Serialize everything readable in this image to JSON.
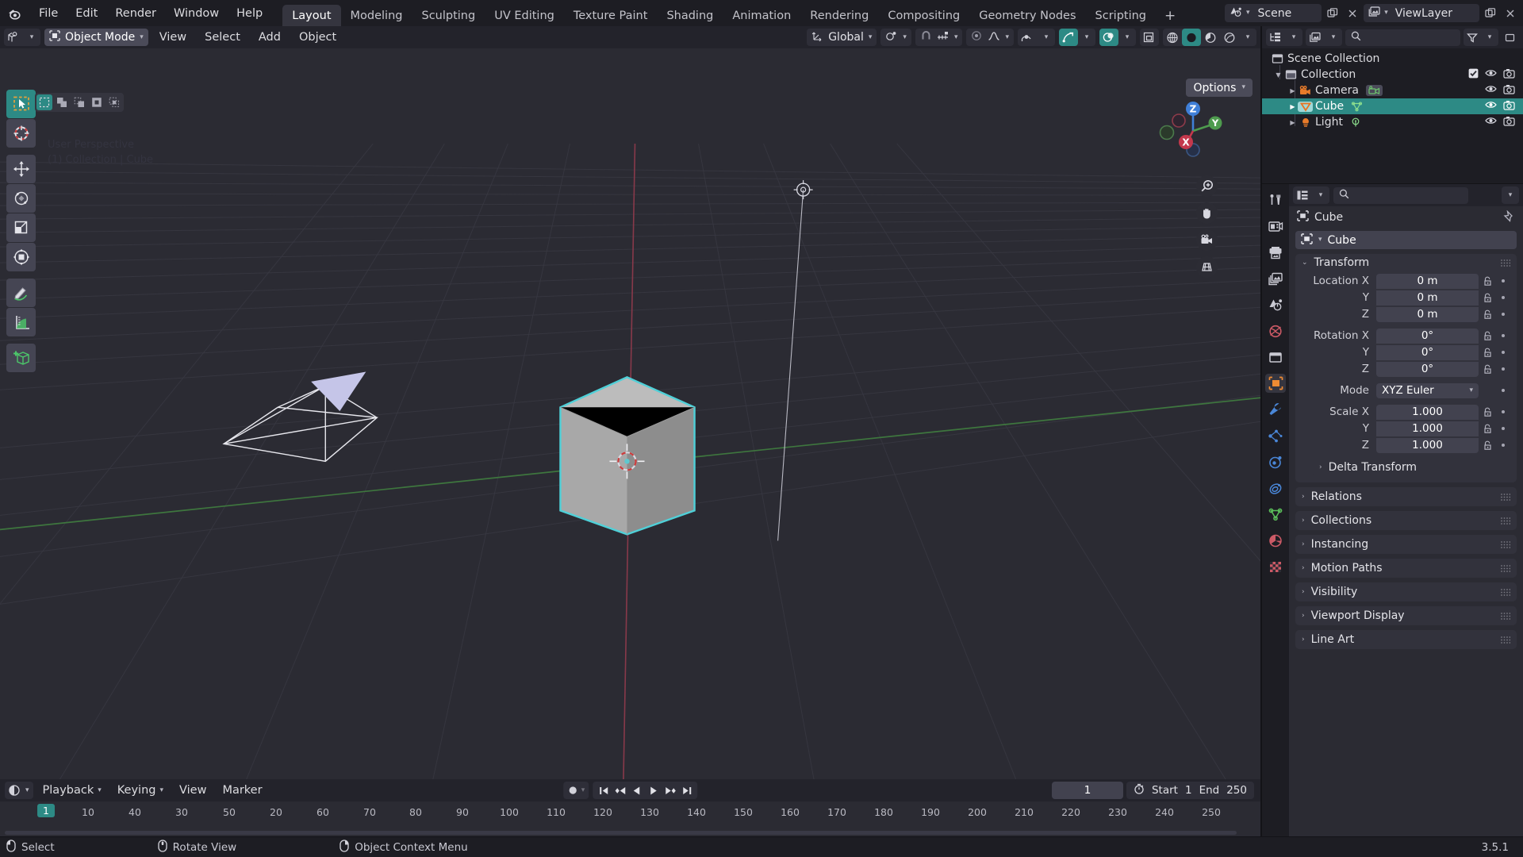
{
  "app": {
    "version": "3.5.1",
    "logo_icon": "blender-logo"
  },
  "topbar": {
    "menus": [
      "File",
      "Edit",
      "Render",
      "Window",
      "Help"
    ],
    "workspace_tabs": [
      {
        "label": "Layout",
        "active": true
      },
      {
        "label": "Modeling",
        "active": false
      },
      {
        "label": "Sculpting",
        "active": false
      },
      {
        "label": "UV Editing",
        "active": false
      },
      {
        "label": "Texture Paint",
        "active": false
      },
      {
        "label": "Shading",
        "active": false
      },
      {
        "label": "Animation",
        "active": false
      },
      {
        "label": "Rendering",
        "active": false
      },
      {
        "label": "Compositing",
        "active": false
      },
      {
        "label": "Geometry Nodes",
        "active": false
      },
      {
        "label": "Scripting",
        "active": false
      }
    ],
    "add_workspace_label": "+",
    "scene_name": "Scene",
    "viewlayer_name": "ViewLayer",
    "scene_icon": "scene-icon",
    "viewlayer_icon": "viewlayer-icon",
    "new_scene_icon": "new-scene-icon",
    "remove_scene_icon": "remove-scene-icon",
    "new_viewlayer_icon": "new-viewlayer-icon",
    "remove_viewlayer_icon": "remove-viewlayer-icon"
  },
  "viewport_header": {
    "editor_type_icon": "editor-type-3dview-icon",
    "mode": "Object Mode",
    "mode_icon": "object-mode-icon",
    "menus": [
      "View",
      "Select",
      "Add",
      "Object"
    ],
    "orientation": "Global",
    "orientation_icon": "orientation-icon",
    "pivot_icon": "pivot-point-icon",
    "snap_icon": "snap-magnet-icon",
    "snap_target_icon": "snap-increment-icon",
    "proportional_icon": "proportional-editing-icon",
    "falloff_icon": "proportional-falloff-icon",
    "options_label": "Options",
    "select_modes": [
      "set",
      "extend",
      "subtract",
      "invert",
      "intersect"
    ],
    "right_icons": [
      {
        "name": "visibility-icon",
        "on": false
      },
      {
        "name": "gizmo-icon",
        "on": true
      },
      {
        "name": "overlays-icon",
        "on": true
      },
      {
        "name": "xray-toggle-icon",
        "on": false
      },
      {
        "name": "shading-wireframe-icon",
        "on": false
      },
      {
        "name": "shading-solid-icon",
        "on": true
      },
      {
        "name": "shading-material-icon",
        "on": false
      },
      {
        "name": "shading-rendered-icon",
        "on": false
      }
    ]
  },
  "viewport": {
    "overlay_line1": "User Perspective",
    "overlay_line2": "(1) Collection | Cube",
    "gizmo_axes": [
      "X",
      "Y",
      "Z"
    ],
    "nav_buttons": [
      "zoom-icon",
      "pan-hand-icon",
      "camera-view-icon",
      "toggle-perspective-icon"
    ],
    "tools": [
      {
        "name": "tweak-select-box-tool",
        "active": true
      },
      {
        "name": "cursor-tool",
        "active": false
      },
      {
        "name": "move-tool",
        "active": false
      },
      {
        "name": "rotate-tool",
        "active": false
      },
      {
        "name": "scale-tool",
        "active": false
      },
      {
        "name": "transform-tool",
        "active": false
      },
      {
        "name": "annotate-tool",
        "active": false
      },
      {
        "name": "measure-tool",
        "active": false
      },
      {
        "name": "add-cube-tool",
        "active": false
      }
    ],
    "objects": [
      "Cube",
      "Camera",
      "Light"
    ],
    "selected_object": "Cube"
  },
  "timeline": {
    "editor_icon": "timeline-editor-icon",
    "menus": [
      "Playback",
      "Keying",
      "View",
      "Marker"
    ],
    "auto_key_icon": "record-autokey-icon",
    "transport": [
      "jump-to-start-icon",
      "jump-to-prev-keyframe-icon",
      "play-reverse-icon",
      "play-icon",
      "jump-to-next-keyframe-icon",
      "jump-to-end-icon"
    ],
    "current_frame": "1",
    "clock_icon": "playhead-clock-icon",
    "start_label": "Start",
    "start_value": "1",
    "end_label": "End",
    "end_value": "250",
    "playhead_frame": "1",
    "ruler_ticks": [
      "10",
      "20",
      "30",
      "40",
      "50",
      "60",
      "70",
      "80",
      "90",
      "100",
      "110",
      "120",
      "130",
      "140",
      "150",
      "160",
      "170",
      "180",
      "190",
      "200",
      "210",
      "220",
      "230",
      "240",
      "250"
    ]
  },
  "outliner": {
    "display_mode_icon": "outliner-display-mode-icon",
    "filter_id_icon": "outliner-id-type-icon",
    "search_placeholder": "",
    "search_icon": "search-icon",
    "filter_icon": "filter-funnel-icon",
    "rows": [
      {
        "label": "Scene Collection",
        "icon": "scene-collection-icon",
        "indent": 0,
        "disclosure": "",
        "selected": false,
        "checkbox": false,
        "eye": false,
        "camera": false,
        "data_icon": ""
      },
      {
        "label": "Collection",
        "icon": "collection-icon",
        "indent": 1,
        "disclosure": "down",
        "selected": false,
        "checkbox": true,
        "eye": true,
        "camera": true,
        "data_icon": ""
      },
      {
        "label": "Camera",
        "icon": "camera-object-icon",
        "indent": 2,
        "disclosure": "right",
        "selected": false,
        "checkbox": false,
        "eye": true,
        "camera": true,
        "data_icon": "camera-data-icon"
      },
      {
        "label": "Cube",
        "icon": "mesh-object-icon",
        "indent": 2,
        "disclosure": "right",
        "selected": true,
        "checkbox": false,
        "eye": true,
        "camera": true,
        "data_icon": "mesh-data-icon"
      },
      {
        "label": "Light",
        "icon": "light-object-icon",
        "indent": 2,
        "disclosure": "right",
        "selected": false,
        "checkbox": false,
        "eye": true,
        "camera": true,
        "data_icon": "light-data-icon"
      }
    ]
  },
  "properties": {
    "editor_icon": "properties-editor-icon",
    "search_placeholder": "",
    "breadcrumb": "Cube",
    "breadcrumb_icon": "object-properties-icon",
    "pin_icon": "pin-icon",
    "id_name": "Cube",
    "id_icon": "object-properties-icon",
    "tabs": [
      {
        "name": "tool-tab",
        "icon": "tool-icon",
        "active": false,
        "color": "#c9c9d2"
      },
      {
        "name": "render-tab",
        "icon": "render-camera-back-icon",
        "active": false,
        "color": "#c9c9d2"
      },
      {
        "name": "output-tab",
        "icon": "printer-icon",
        "active": false,
        "color": "#c9c9d2"
      },
      {
        "name": "viewlayer-tab",
        "icon": "images-icon",
        "active": false,
        "color": "#c9c9d2"
      },
      {
        "name": "scene-tab",
        "icon": "scene-cone-icon",
        "active": false,
        "color": "#c9c9d2"
      },
      {
        "name": "world-tab",
        "icon": "world-globe-icon",
        "active": false,
        "color": "#cc5a66"
      },
      {
        "name": "collection-tab",
        "icon": "collection-box-icon",
        "active": false,
        "color": "#c9c9d2"
      },
      {
        "name": "object-tab",
        "icon": "object-square-icon",
        "active": true,
        "color": "#ef8b33"
      },
      {
        "name": "modifiers-tab",
        "icon": "wrench-icon",
        "active": false,
        "color": "#4a87d8"
      },
      {
        "name": "particles-tab",
        "icon": "particles-icon",
        "active": false,
        "color": "#4a87d8"
      },
      {
        "name": "physics-tab",
        "icon": "physics-orbit-icon",
        "active": false,
        "color": "#4a87d8"
      },
      {
        "name": "constraints-tab",
        "icon": "constraints-icon",
        "active": false,
        "color": "#4a87d8"
      },
      {
        "name": "data-tab",
        "icon": "mesh-data-triangle-icon",
        "active": false,
        "color": "#5bbf5b"
      },
      {
        "name": "material-tab",
        "icon": "material-sphere-icon",
        "active": false,
        "color": "#cc5a66"
      },
      {
        "name": "texture-tab",
        "icon": "texture-checker-icon",
        "active": false,
        "color": "#cc5a66"
      }
    ],
    "transform_panel": {
      "title": "Transform",
      "location": {
        "label": "Location X",
        "labels": [
          "Location X",
          "Y",
          "Z"
        ],
        "values": [
          "0 m",
          "0 m",
          "0 m"
        ]
      },
      "rotation": {
        "labels": [
          "Rotation X",
          "Y",
          "Z"
        ],
        "values": [
          "0°",
          "0°",
          "0°"
        ]
      },
      "mode": {
        "label": "Mode",
        "value": "XYZ Euler"
      },
      "scale": {
        "labels": [
          "Scale X",
          "Y",
          "Z"
        ],
        "values": [
          "1.000",
          "1.000",
          "1.000"
        ]
      },
      "delta_transform": "Delta Transform"
    },
    "collapsed_panels": [
      "Relations",
      "Collections",
      "Instancing",
      "Motion Paths",
      "Visibility",
      "Viewport Display",
      "Line Art"
    ]
  },
  "status": {
    "items": [
      {
        "label": "Select",
        "icon": "mouse-left-icon"
      },
      {
        "label": "Rotate View",
        "icon": "mouse-middle-icon"
      },
      {
        "label": "Object Context Menu",
        "icon": "mouse-right-icon"
      }
    ],
    "version": "3.5.1"
  },
  "colors": {
    "accent_teal": "#2d8a85",
    "selected_outline": "#4fd0d8",
    "axis_x": "#9b3a4e",
    "axis_y": "#3f7a3f",
    "object_orange": "#ef8b33",
    "bg_dark": "#1d1d23",
    "viewport_bg": "#2b2b33"
  }
}
